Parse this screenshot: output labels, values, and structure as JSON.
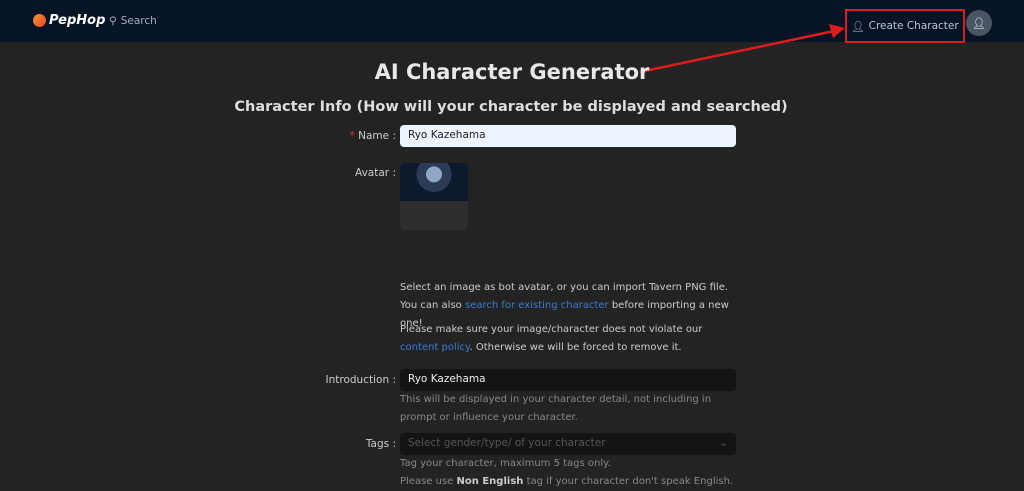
{
  "header": {
    "brand": "PepHop",
    "search": "Search",
    "create": "Create Character"
  },
  "title": "AI Character Generator",
  "subtitle": "Character Info (How will your character be displayed and searched)",
  "form": {
    "name_label": "Name",
    "name_value": "Ryo Kazehama",
    "avatar_label": "Avatar",
    "avatar_help_1": "Select an image as bot avatar, or you can import Tavern PNG file. You can also ",
    "avatar_link": "search for existing character",
    "avatar_help_2": " before importing a new one!",
    "policy_1": "Please make sure your image/character does not violate our ",
    "policy_link": "content policy",
    "policy_2": ". Otherwise we will be forced to remove it.",
    "intro_label": "Introduction",
    "intro_value": "Ryo Kazehama",
    "intro_help": "This will be displayed in your character detail, not including in prompt or influence your character.",
    "tags_label": "Tags",
    "tags_placeholder": "Select gender/type/ of your character",
    "tags_help_1": "Tag your character, maximum 5 tags only.",
    "tags_help_2a": "Please use ",
    "tags_help_bold": "Non English",
    "tags_help_2b": " tag if your character don't speak English."
  },
  "annotation_color": "#e01b1b"
}
